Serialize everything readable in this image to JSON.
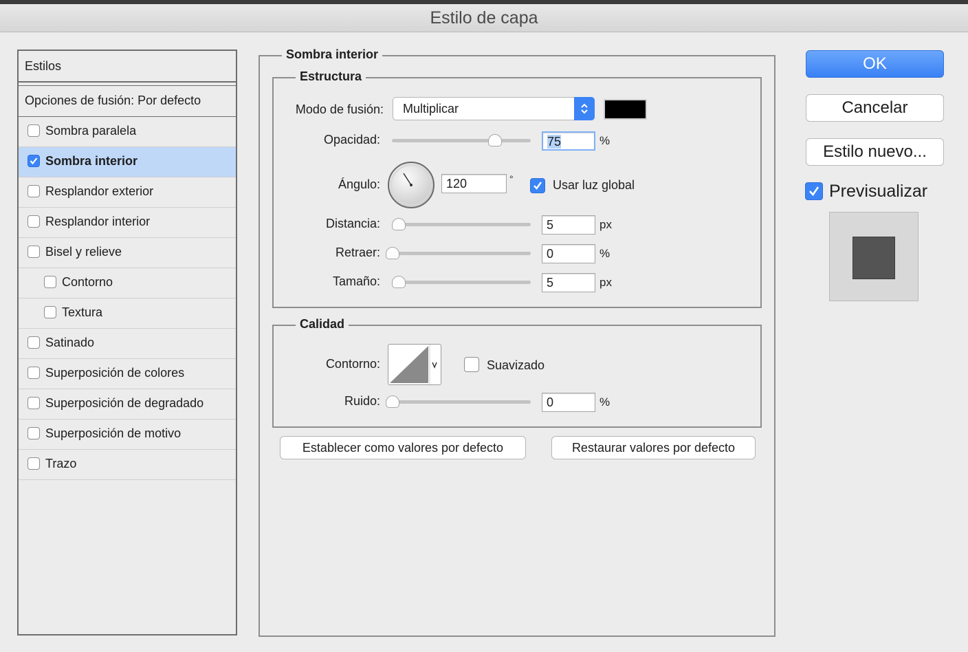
{
  "window": {
    "title": "Estilo de capa"
  },
  "styles_panel": {
    "header": "Estilos",
    "blend_options": "Opciones de fusión: Por defecto",
    "items": [
      {
        "label": "Sombra paralela",
        "checked": false,
        "selected": false,
        "indent": false
      },
      {
        "label": "Sombra interior",
        "checked": true,
        "selected": true,
        "indent": false
      },
      {
        "label": "Resplandor exterior",
        "checked": false,
        "selected": false,
        "indent": false
      },
      {
        "label": "Resplandor interior",
        "checked": false,
        "selected": false,
        "indent": false
      },
      {
        "label": "Bisel y relieve",
        "checked": false,
        "selected": false,
        "indent": false
      },
      {
        "label": "Contorno",
        "checked": false,
        "selected": false,
        "indent": true
      },
      {
        "label": "Textura",
        "checked": false,
        "selected": false,
        "indent": true
      },
      {
        "label": "Satinado",
        "checked": false,
        "selected": false,
        "indent": false
      },
      {
        "label": "Superposición de colores",
        "checked": false,
        "selected": false,
        "indent": false
      },
      {
        "label": "Superposición de degradado",
        "checked": false,
        "selected": false,
        "indent": false
      },
      {
        "label": "Superposición de motivo",
        "checked": false,
        "selected": false,
        "indent": false
      },
      {
        "label": "Trazo",
        "checked": false,
        "selected": false,
        "indent": false
      }
    ]
  },
  "inner_shadow": {
    "title": "Sombra interior",
    "structure": {
      "title": "Estructura",
      "blend_mode_label": "Modo de fusión:",
      "blend_mode_value": "Multiplicar",
      "shadow_color": "#000000",
      "opacity_label": "Opacidad:",
      "opacity_value": "75",
      "opacity_unit": "%",
      "angle_label": "Ángulo:",
      "angle_value": "120",
      "angle_unit": "°",
      "global_light_label": "Usar luz global",
      "global_light_checked": true,
      "distance_label": "Distancia:",
      "distance_value": "5",
      "distance_unit": "px",
      "choke_label": "Retraer:",
      "choke_value": "0",
      "choke_unit": "%",
      "size_label": "Tamaño:",
      "size_value": "5",
      "size_unit": "px"
    },
    "quality": {
      "title": "Calidad",
      "contour_label": "Contorno:",
      "antialiased_label": "Suavizado",
      "antialiased_checked": false,
      "noise_label": "Ruido:",
      "noise_value": "0",
      "noise_unit": "%"
    },
    "make_default_label": "Establecer como valores por defecto",
    "reset_default_label": "Restaurar valores por defecto"
  },
  "buttons": {
    "ok": "OK",
    "cancel": "Cancelar",
    "new_style": "Estilo nuevo...",
    "preview_label": "Previsualizar",
    "preview_checked": true
  },
  "colors": {
    "accent": "#3b84f6",
    "selection": "#c0d8f8",
    "preview_square": "#545454"
  }
}
